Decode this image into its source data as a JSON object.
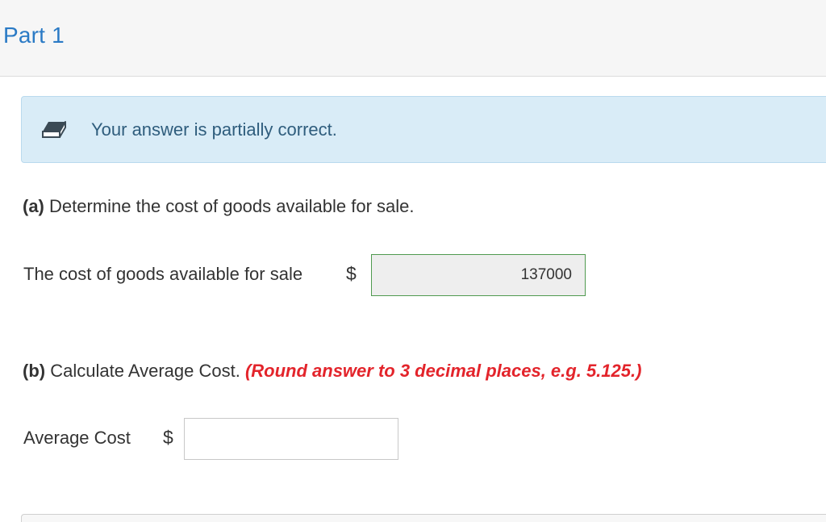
{
  "header": {
    "title": "Part 1"
  },
  "feedback": {
    "icon": "eraser-icon",
    "message": "Your answer is partially correct.",
    "background_color": "#d9ecf7"
  },
  "question_a": {
    "prefix": "(a)",
    "text": " Determine the cost of goods available for sale.",
    "field_label": "The cost of goods available for sale",
    "currency": "$",
    "value": "137000",
    "status": "correct"
  },
  "question_b": {
    "prefix": "(b)",
    "text": " Calculate Average Cost. ",
    "note": "(Round answer to 3 decimal places, e.g. 5.125.)",
    "note_color": "#e3242b",
    "field_label": "Average Cost",
    "currency": "$",
    "value": ""
  }
}
